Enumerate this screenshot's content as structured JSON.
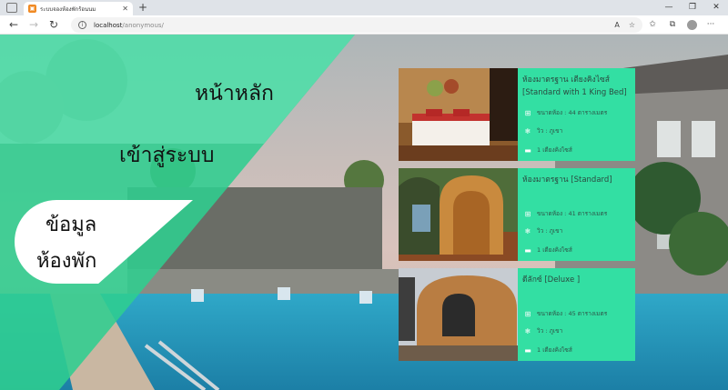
{
  "browser": {
    "tab_title": "ระบบจองห้องพักร้อนนม",
    "url_host": "localhost",
    "url_path": "/anonymous/",
    "new_tab_glyph": "+",
    "read_aloud_label": "A",
    "icons": [
      "tab-actions-icon",
      "close-icon",
      "back-icon",
      "forward-icon",
      "refresh-icon",
      "info-icon",
      "read-aloud-icon",
      "add-favorite-icon",
      "favorites-icon",
      "collections-icon",
      "profile-icon",
      "more-icon",
      "minimize-icon",
      "maximize-icon"
    ]
  },
  "nav": {
    "home": "หน้าหลัก",
    "login": "เข้าสู่ระบบ",
    "rooms_line1": "ข้อมูล",
    "rooms_line2": "ห้องพัก"
  },
  "colors": {
    "accent_green": "#33dfa3",
    "panel_green": "#2fce8f",
    "active_white": "#ffffff"
  },
  "rooms": [
    {
      "name": "ห้องมาตรฐาน เตียงคิงไซส์ [Standard with 1 King Bed]",
      "size": "ขนาดห้อง : 44 ตารางเมตร",
      "view": "วิว : ภูเขา",
      "bed": "1 เตียงคิงไซส์"
    },
    {
      "name": "ห้องมาตรฐาน [Standard]",
      "size": "ขนาดห้อง : 41 ตารางเมตร",
      "view": "วิว : ภูเขา",
      "bed": "1 เตียงคิงไซส์"
    },
    {
      "name": "ดีลักซ์ [Deluxe ]",
      "size": "ขนาดห้อง : 45 ตารางเมตร",
      "view": "วิว : ภูเขา",
      "bed": "1 เตียงคิงไซส์"
    }
  ]
}
